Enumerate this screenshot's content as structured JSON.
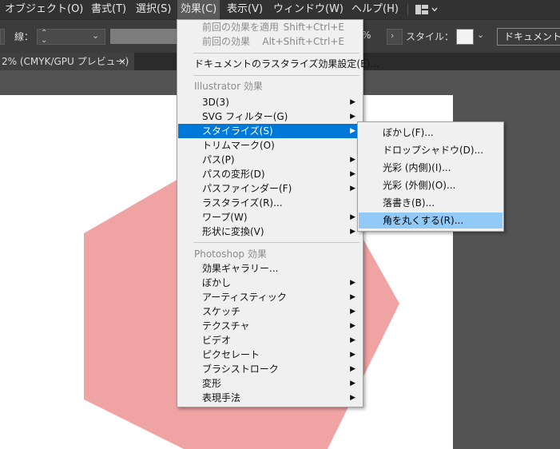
{
  "menubar": {
    "items": [
      {
        "label": "オブジェクト(O)"
      },
      {
        "label": "書式(T)"
      },
      {
        "label": "選択(S)"
      },
      {
        "label": "効果(C)"
      },
      {
        "label": "表示(V)"
      },
      {
        "label": "ウィンドウ(W)"
      },
      {
        "label": "ヘルプ(H)"
      }
    ],
    "workspace_icon": "workspace-grid-icon"
  },
  "controlbar": {
    "stroke_label": "線：",
    "opacity_suffix": "%",
    "style_label": "スタイル：",
    "document_button": "ドキュメント"
  },
  "tab": {
    "title": "2% (CMYK/GPU プレビュー)",
    "close": "×"
  },
  "effect_menu": {
    "items": [
      {
        "label": "前回の効果を適用",
        "shortcut": "Shift+Ctrl+E",
        "state": "disabled"
      },
      {
        "label": "前回の効果",
        "shortcut": "Alt+Shift+Ctrl+E",
        "state": "disabled"
      },
      {
        "label": "ドキュメントのラスタライズ効果設定(E)..."
      },
      {
        "label": "Illustrator 効果",
        "state": "header"
      },
      {
        "label": "3D(3)",
        "submenu": true
      },
      {
        "label": "SVG フィルター(G)",
        "submenu": true
      },
      {
        "label": "スタイライズ(S)",
        "submenu": true,
        "state": "selected"
      },
      {
        "label": "トリムマーク(O)"
      },
      {
        "label": "パス(P)",
        "submenu": true
      },
      {
        "label": "パスの変形(D)",
        "submenu": true
      },
      {
        "label": "パスファインダー(F)",
        "submenu": true
      },
      {
        "label": "ラスタライズ(R)..."
      },
      {
        "label": "ワープ(W)",
        "submenu": true
      },
      {
        "label": "形状に変換(V)",
        "submenu": true
      },
      {
        "label": "Photoshop 効果",
        "state": "header"
      },
      {
        "label": "効果ギャラリー..."
      },
      {
        "label": "ぼかし",
        "submenu": true
      },
      {
        "label": "アーティスティック",
        "submenu": true
      },
      {
        "label": "スケッチ",
        "submenu": true
      },
      {
        "label": "テクスチャ",
        "submenu": true
      },
      {
        "label": "ビデオ",
        "submenu": true
      },
      {
        "label": "ピクセレート",
        "submenu": true
      },
      {
        "label": "ブラシストローク",
        "submenu": true
      },
      {
        "label": "変形",
        "submenu": true
      },
      {
        "label": "表現手法",
        "submenu": true
      }
    ]
  },
  "stylize_submenu": {
    "items": [
      {
        "label": "ぼかし(F)..."
      },
      {
        "label": "ドロップシャドウ(D)..."
      },
      {
        "label": "光彩 (内側)(I)..."
      },
      {
        "label": "光彩 (外側)(O)..."
      },
      {
        "label": "落書き(B)..."
      },
      {
        "label": "角を丸くする(R)...",
        "state": "hover"
      }
    ]
  },
  "colors": {
    "hexagon_fill": "#f0a3a3",
    "menu_selected": "#0078d7",
    "submenu_hover": "#91c9f7"
  }
}
